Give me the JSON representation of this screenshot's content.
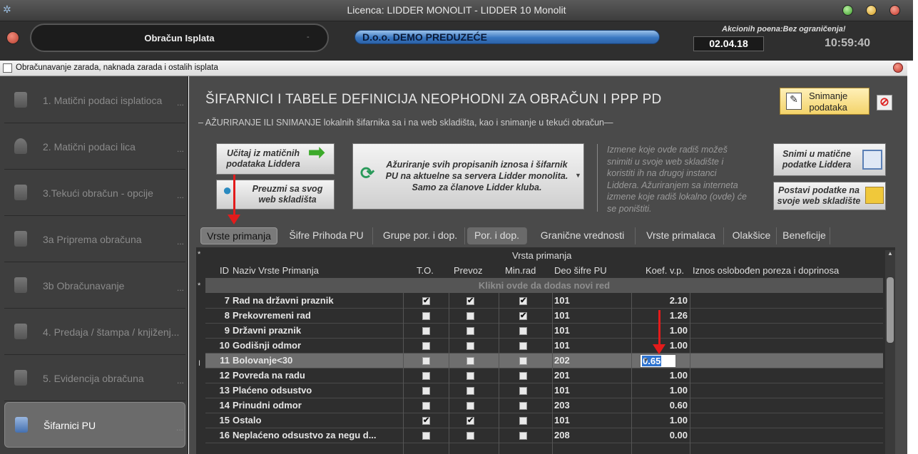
{
  "window": {
    "title": "Licenca: LIDDER MONOLIT - LIDDER 10 Monolit"
  },
  "header": {
    "section": "Obračun Isplata",
    "section_suffix": "-",
    "company": "D.o.o. DEMO PREDUZEĆE",
    "points": "Akcionih poena:Bez ograničenja!",
    "date": "02.04.18",
    "time": "10:59:40"
  },
  "subwindow": {
    "title": "Obračunavanje zarada, naknada zarada i ostalih isplata"
  },
  "sidebar": {
    "items": [
      {
        "label": "1. Matični podaci isplatioca",
        "dots": "..."
      },
      {
        "label": "2. Matični podaci lica",
        "dots": "..."
      },
      {
        "label": "3.Tekući obračun - opcije",
        "dots": "..."
      },
      {
        "label": "3a Priprema obračuna",
        "dots": "..."
      },
      {
        "label": "3b Obračunavanje",
        "dots": "..."
      },
      {
        "label": "4. Predaja / štampa / knjiženj...",
        "dots": ""
      },
      {
        "label": "5. Evidencija obračuna",
        "dots": "..."
      },
      {
        "label": "Šifarnici PU",
        "dots": "..."
      }
    ]
  },
  "main": {
    "title": "ŠIFARNICI I TABELE DEFINICIJA NEOPHODNI ZA OBRAČUN I PPP PD",
    "subtitle": "– AŽURIRANJE ILI SNIMANJE lokalnih šifarnika sa i na web skladišta, kao i snimanje u tekući obračun—",
    "save_label_1": "Snimanje",
    "save_label_2": "podataka",
    "load_label_1": "Učitaj iz matičnih",
    "load_label_2": "podataka Liddera",
    "fetch_label_1": "Preuzmi sa svog",
    "fetch_label_2": "web skladišta",
    "update_label_1": "Ažuriranje svih propisanih iznosa i šifarnik",
    "update_label_2": "PU na aktuelne sa servera Lidder monolita.",
    "update_label_3": "Samo za članove Lidder kluba.",
    "note": "Izmene koje ovde radiš možeš snimiti u svoje web skladište i koristiti ih na drugoj instanci Liddera. Ažuriranjem sa interneta izmene koje radiš lokalno (ovde) će se poništiti.",
    "save_master_1": "Snimi u matične",
    "save_master_2": "podatke Liddera",
    "post_web_1": "Postavi podatke na",
    "post_web_2": "svoje web skladište"
  },
  "tabs": [
    "Vrste primanja",
    "Šifre Prihoda PU",
    "Grupe por. i dop.",
    "Por. i dop.",
    "Granične vrednosti",
    "Vrste primalaca",
    "Olakšice",
    "Beneficije"
  ],
  "grid": {
    "group_header": "Vrsta primanja",
    "columns": [
      "ID",
      "Naziv Vrste Primanja",
      "T.O.",
      "Prevoz",
      "Min.rad",
      "Deo šifre PU",
      "Koef. v.p.",
      "Iznos oslobođen poreza i doprinosa"
    ],
    "add_row": "Klikni ovde da dodas novi red",
    "star": "*",
    "edit_marker": "I",
    "rows": [
      {
        "id": "7",
        "name": "Rad na državni praznik",
        "to": true,
        "prevoz": true,
        "minrad": true,
        "deo": "101",
        "koef": "2.10"
      },
      {
        "id": "8",
        "name": "Prekovremeni rad",
        "to": false,
        "prevoz": false,
        "minrad": true,
        "deo": "101",
        "koef": "1.26"
      },
      {
        "id": "9",
        "name": "Državni praznik",
        "to": false,
        "prevoz": false,
        "minrad": false,
        "deo": "101",
        "koef": "1.00"
      },
      {
        "id": "10",
        "name": "Godišnji odmor",
        "to": false,
        "prevoz": false,
        "minrad": false,
        "deo": "101",
        "koef": "1.00"
      },
      {
        "id": "11",
        "name": "Bolovanje<30",
        "to": false,
        "prevoz": false,
        "minrad": false,
        "deo": "202",
        "koef": "0.65"
      },
      {
        "id": "12",
        "name": "Povreda na radu",
        "to": false,
        "prevoz": false,
        "minrad": false,
        "deo": "201",
        "koef": "1.00"
      },
      {
        "id": "13",
        "name": "Plaćeno odsustvo",
        "to": false,
        "prevoz": false,
        "minrad": false,
        "deo": "101",
        "koef": "1.00"
      },
      {
        "id": "14",
        "name": "Prinudni odmor",
        "to": false,
        "prevoz": false,
        "minrad": false,
        "deo": "203",
        "koef": "0.60"
      },
      {
        "id": "15",
        "name": "Ostalo",
        "to": true,
        "prevoz": true,
        "minrad": false,
        "deo": "101",
        "koef": "1.00"
      },
      {
        "id": "16",
        "name": "Neplaćeno odsustvo za negu d...",
        "to": false,
        "prevoz": false,
        "minrad": false,
        "deo": "208",
        "koef": "0.00"
      }
    ]
  }
}
